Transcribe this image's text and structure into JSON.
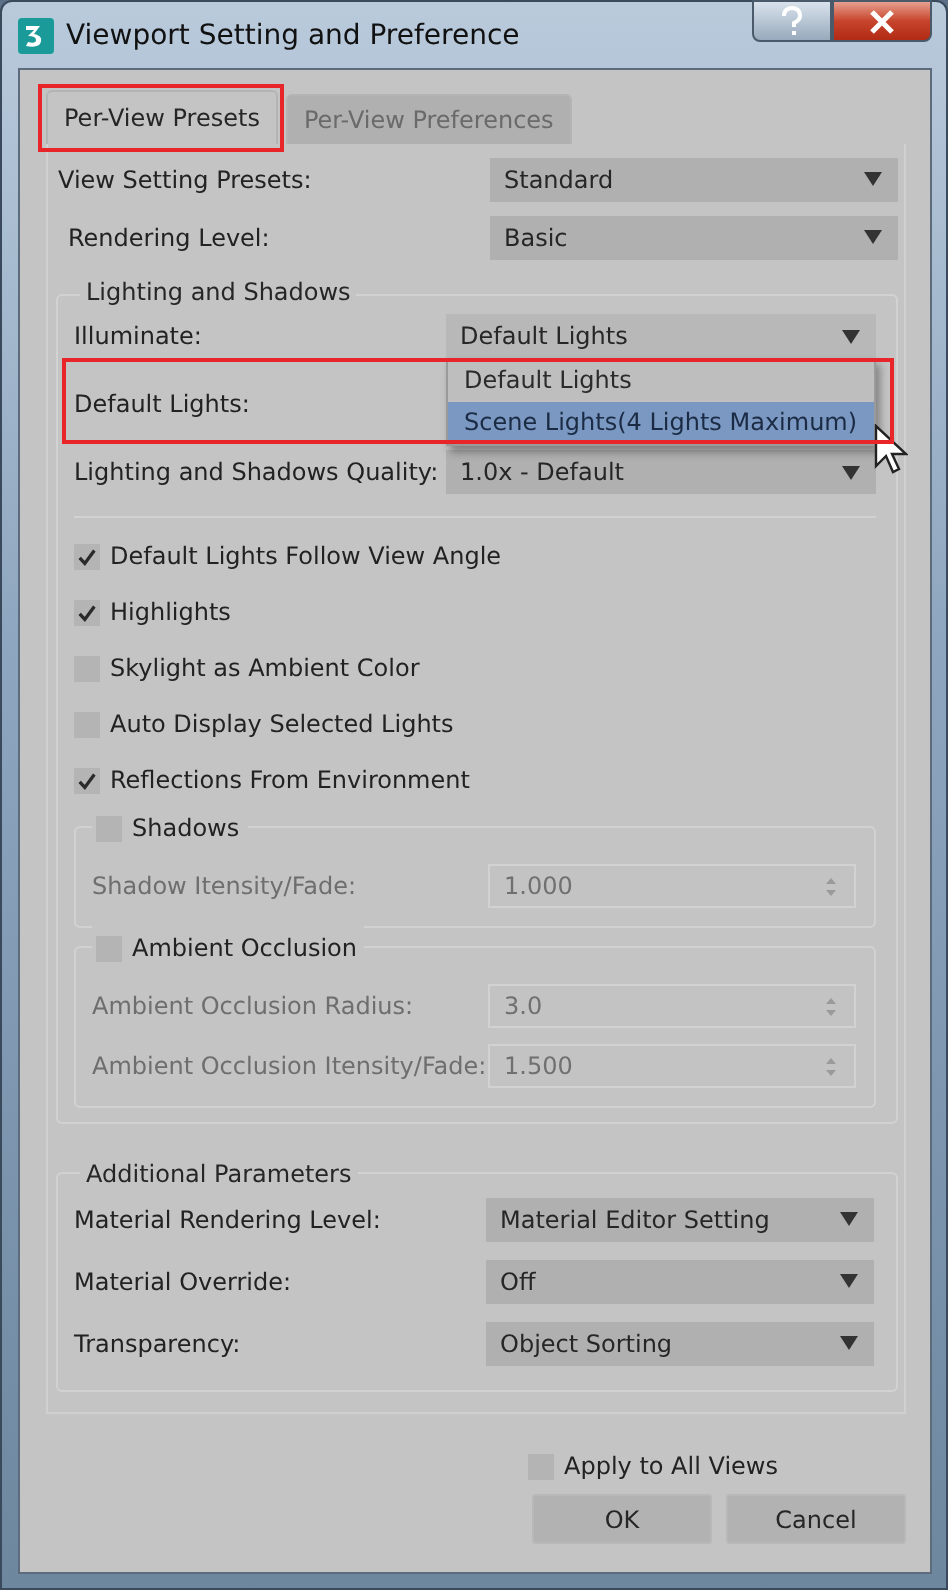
{
  "window": {
    "title": "Viewport Setting and Preference"
  },
  "tabs": [
    {
      "label": "Per-View Presets",
      "selected": true,
      "annotated": true
    },
    {
      "label": "Per-View Preferences",
      "selected": false,
      "annotated": false
    }
  ],
  "presets": [
    {
      "label": "View Setting Presets:",
      "value": "Standard"
    },
    {
      "label": "Rendering Level:",
      "value": "Basic"
    }
  ],
  "lighting": {
    "title": "Lighting and Shadows",
    "rows": [
      {
        "label": "Illuminate:",
        "value": "Default Lights",
        "annotated": false,
        "options": [
          {
            "label": "Default Lights",
            "highlighted": false
          },
          {
            "label": "Scene Lights(4 Lights Maximum)",
            "highlighted": true
          }
        ]
      },
      {
        "label": "Default Lights:",
        "annotated": true
      },
      {
        "label": "Lighting and Shadows Quality:",
        "value": "1.0x - Default",
        "annotated": false
      }
    ],
    "checkboxes": [
      {
        "label": "Default Lights Follow View Angle",
        "checked": true
      },
      {
        "label": "Highlights",
        "checked": true
      },
      {
        "label": "Skylight as Ambient Color",
        "checked": false
      },
      {
        "label": "Auto Display Selected Lights",
        "checked": false
      },
      {
        "label": "Reflections From Environment",
        "checked": true
      }
    ],
    "subgroups": [
      {
        "label": "Shadows",
        "checked": false,
        "fields": [
          {
            "label": "Shadow Itensity/Fade:",
            "value": "1.000",
            "disabled": true
          }
        ]
      },
      {
        "label": "Ambient Occlusion",
        "checked": false,
        "fields": [
          {
            "label": "Ambient Occlusion Radius:",
            "value": "3.0",
            "disabled": true
          },
          {
            "label": "Ambient Occlusion Itensity/Fade:",
            "value": "1.500",
            "disabled": true
          }
        ]
      }
    ]
  },
  "additional_parameters": {
    "title": "Additional Parameters",
    "rows": [
      {
        "label": "Material Rendering Level:",
        "value": "Material Editor Setting"
      },
      {
        "label": "Material Override:",
        "value": "Off"
      },
      {
        "label": "Transparency:",
        "value": "Object Sorting"
      }
    ]
  },
  "apply_all": {
    "label": "Apply to All Views",
    "checked": false
  },
  "buttons": [
    {
      "label": "OK"
    },
    {
      "label": "Cancel"
    }
  ]
}
